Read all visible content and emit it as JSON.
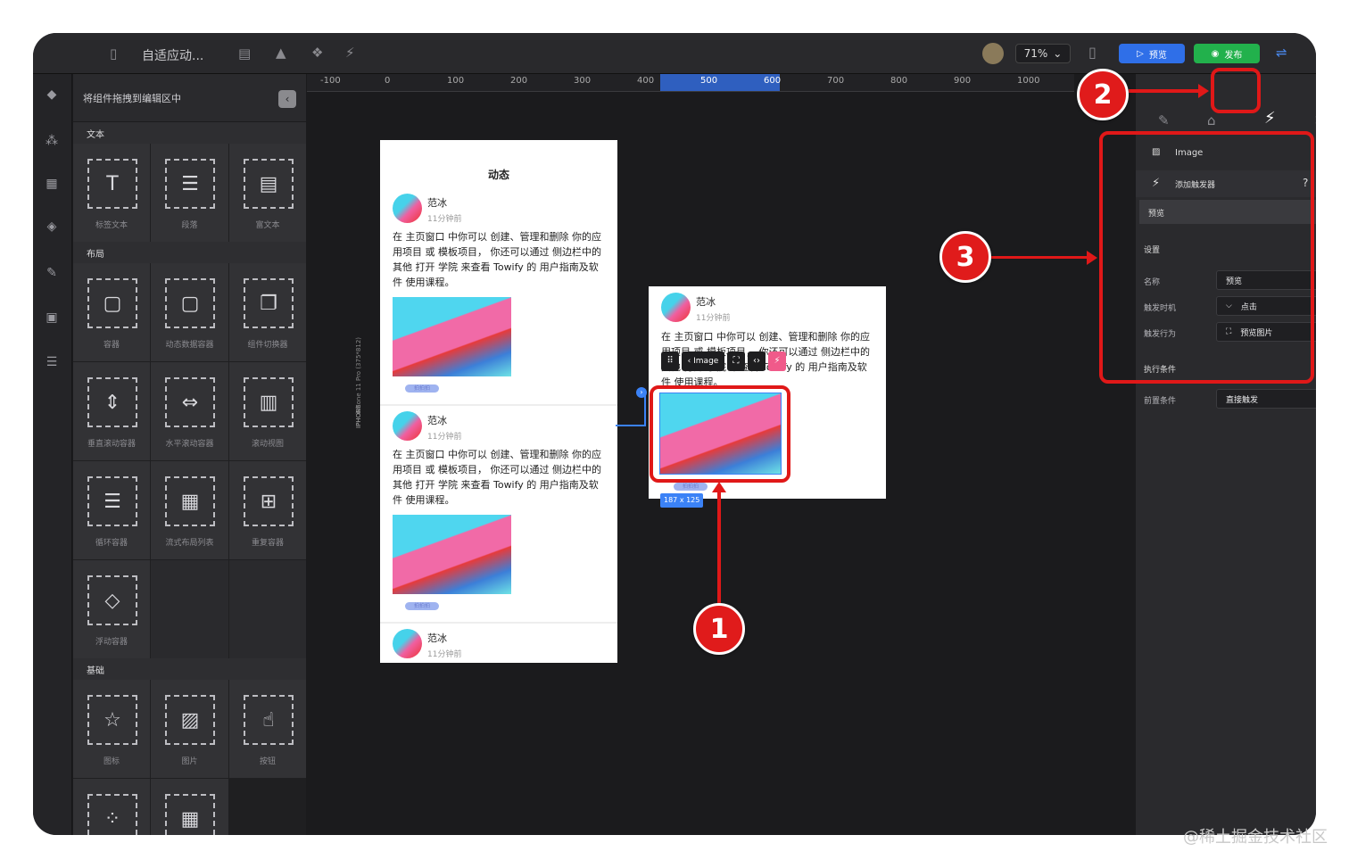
{
  "app": {
    "title": "自适应动...",
    "zoom": "71%",
    "preview_label": "预览",
    "publish_label": "发布"
  },
  "panel": {
    "hint": "将组件拖拽到编辑区中",
    "sections": [
      {
        "title": "文本",
        "items": [
          "标签文本",
          "段落",
          "富文本"
        ]
      },
      {
        "title": "布局",
        "items": [
          "容器",
          "动态数据容器",
          "组件切换器",
          "垂直滚动容器",
          "水平滚动容器",
          "滚动视图",
          "循环容器",
          "流式布局列表",
          "重复容器",
          "浮动容器"
        ]
      },
      {
        "title": "基础",
        "items": [
          "图标",
          "图片",
          "按钮",
          "",
          ""
        ]
      }
    ]
  },
  "ruler": [
    "-100",
    "0",
    "100",
    "200",
    "300",
    "400",
    "500",
    "600",
    "700",
    "800",
    "900",
    "1000"
  ],
  "phone": {
    "title": "动态",
    "device_label": "iPhone 11 Pro (375*812)",
    "device_type": "IPHONE",
    "user": "范冰",
    "time": "11分钟前",
    "text": "在 主页窗口 中你可以 创建、管理和删除 你的应用项目 或 模板项目， 你还可以通过 侧边栏中的 其他 打开 学院 来查看 Towify 的 用户指南及软件 使用课程。",
    "tag": "拍拍拍"
  },
  "card": {
    "user": "范冰",
    "time": "11分钟前",
    "text": "在 主页窗口 中你可以 创建、管理和删除 你的应用项目 或 模板项目， 你还可以通过 侧边栏中的 其他 打开 学院 来查看 Towify 的 用户指南及软件 使用课程。",
    "toolbar_label": "Image",
    "size": "187 x 125",
    "tag": "拍拍拍"
  },
  "rpanel": {
    "component": "Image",
    "add_trigger": "添加触发器",
    "preview": "预览",
    "settings": "设置",
    "name_label": "名称",
    "name_value": "预览",
    "when_label": "触发时机",
    "when_value": "点击",
    "action_label": "触发行为",
    "action_value": "预览图片",
    "cond_title": "执行条件",
    "pre_label": "前置条件",
    "pre_value": "直接触发"
  },
  "badges": {
    "b1": "1",
    "b2": "2",
    "b3": "3"
  },
  "watermark": "@稀土掘金技术社区",
  "colors": {
    "accent": "#3b82f6",
    "publish": "#22c55e",
    "annotation": "#e01818"
  }
}
